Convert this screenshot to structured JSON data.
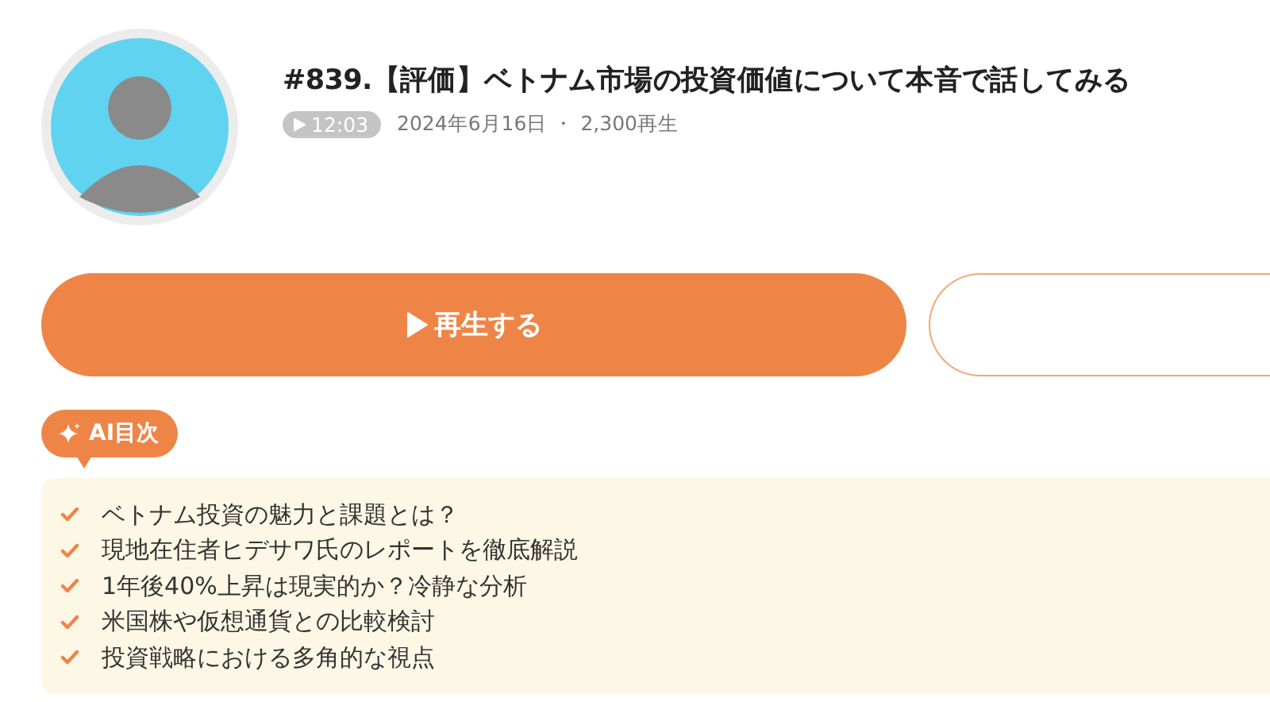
{
  "episode": {
    "title": "#839.【評価】ベトナム市場の投資価値について本音で話してみる",
    "duration": "12:03",
    "date": "2024年6月16日",
    "separator": "・",
    "plays": "2,300再生"
  },
  "actions": {
    "play_label": "再生する"
  },
  "ai_toc": {
    "label": "AI目次",
    "items": [
      "ベトナム投資の魅力と課題とは？",
      "現地在住者ヒデサワ氏のレポートを徹底解説",
      "1年後40%上昇は現実的か？冷静な分析",
      "米国株や仮想通貨との比較検討",
      "投資戦略における多角的な視点"
    ]
  }
}
